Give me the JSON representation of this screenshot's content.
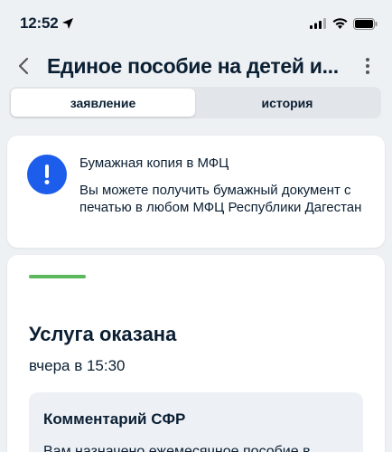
{
  "status_bar": {
    "time": "12:52"
  },
  "header": {
    "title": "Единое пособие на детей и..."
  },
  "tabs": [
    {
      "label": "заявление",
      "active": true
    },
    {
      "label": "история",
      "active": false
    }
  ],
  "info_card": {
    "icon": "exclamation-icon",
    "title": "Бумажная копия в МФЦ",
    "text": "Вы можете получить бумажный документ с печатью в любом МФЦ Республики Дагестан"
  },
  "status_card": {
    "title": "Услуга оказана",
    "time": "вчера в 15:30",
    "comment_title": "Комментарий СФР",
    "comment_text": "Вам назначено ежемесячное пособие в"
  },
  "colors": {
    "accent": "#1d5deb",
    "success": "#5cb85c",
    "background": "#eef1f4"
  }
}
